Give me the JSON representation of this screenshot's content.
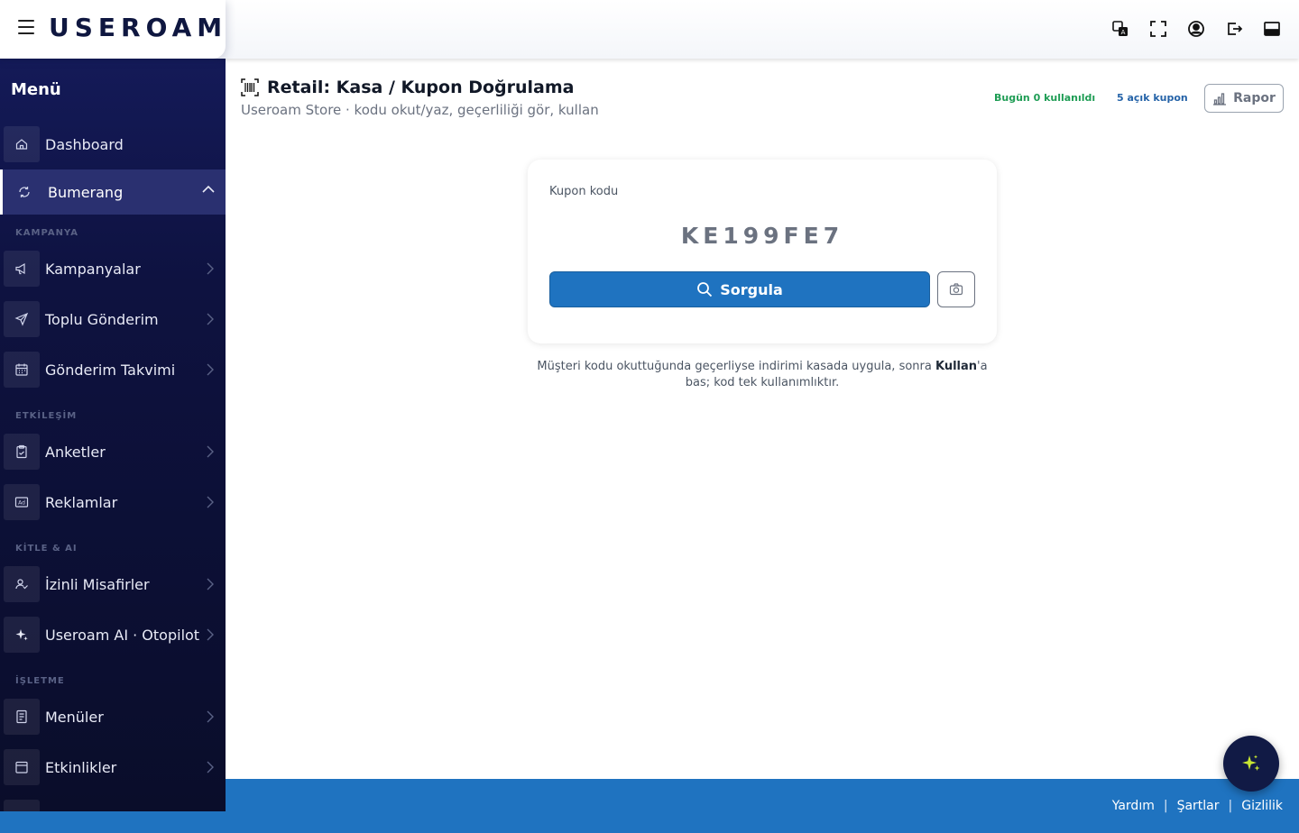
{
  "brand": {
    "logo_text": "USEROAM"
  },
  "topbar": {
    "icons": [
      "translate-icon",
      "fullscreen-icon",
      "user-circle-icon",
      "logout-icon",
      "window-icon"
    ]
  },
  "sidebar": {
    "title": "Menü",
    "items": [
      {
        "label": "Dashboard",
        "icon": "home-icon"
      },
      {
        "label": "Bumerang",
        "icon": "refresh-icon",
        "active": true
      },
      {
        "label": "Kampanyalar",
        "icon": "megaphone-icon"
      },
      {
        "label": "Toplu Gönderim",
        "icon": "send-icon"
      },
      {
        "label": "Gönderim Takvimi",
        "icon": "calendar-icon"
      },
      {
        "label": "Anketler",
        "icon": "clipboard-icon"
      },
      {
        "label": "Reklamlar",
        "icon": "ad-icon"
      },
      {
        "label": "İzinli Misafirler",
        "icon": "user-check-icon"
      },
      {
        "label": "Useroam AI · Otopilot",
        "icon": "sparkle-icon"
      },
      {
        "label": "Menüler",
        "icon": "menu-doc-icon"
      },
      {
        "label": "Etkinlikler",
        "icon": "event-icon"
      }
    ],
    "sections": [
      "KAMPANYA",
      "ETKİLEŞİM",
      "KİTLE & AI",
      "İŞLETME"
    ]
  },
  "header": {
    "title": "Retail: Kasa / Kupon Doğrulama",
    "subtitle": "Useroam Store · kodu okut/yaz, geçerliliği gör, kullan",
    "stat_used": "Bugün 0 kullanıldı",
    "stat_open": "5 açık kupon",
    "report_label": "Rapor"
  },
  "coupon": {
    "label": "Kupon kodu",
    "code_value": "KE199FE7",
    "query_label": "Sorgula"
  },
  "hint": {
    "prefix": "Müşteri kodu okuttuğunda geçerliyse indirimi kasada uygula, sonra ",
    "bold": "Kullan",
    "suffix": "'a bas; kod tek kullanımlıktır."
  },
  "footer": {
    "links": [
      "Yardım",
      "Şartlar",
      "Gizlilik"
    ],
    "separator": "|"
  },
  "colors": {
    "primary": "#1f73c0",
    "sidebar": "#0e1240",
    "success": "#1f9d55",
    "accent_logo": "#c8e632"
  }
}
